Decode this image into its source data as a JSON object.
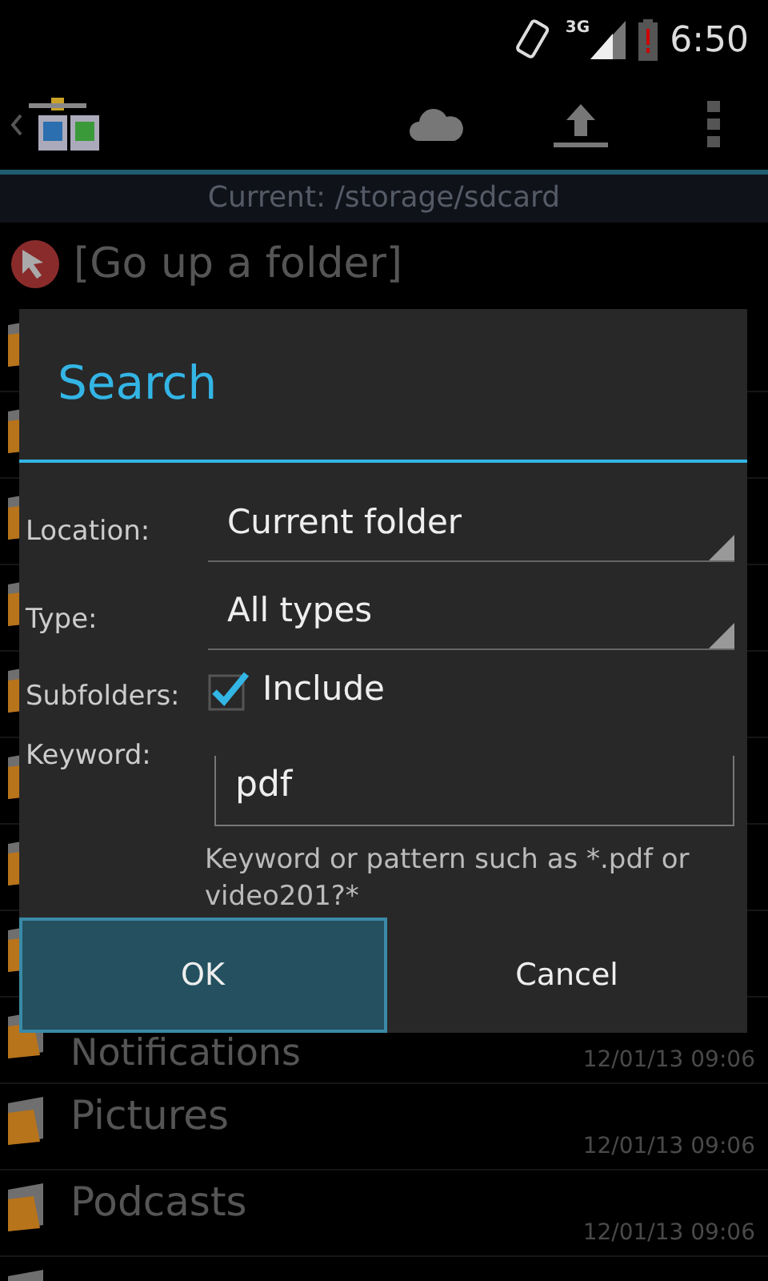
{
  "status_bar": {
    "network": "3G",
    "time": "6:50"
  },
  "action_bar": {
    "path": "Current: /storage/sdcard"
  },
  "go_up": {
    "label": "[Go up a folder]"
  },
  "files": [
    {
      "name": "Notifications",
      "date": "12/01/13 09:06"
    },
    {
      "name": "Pictures",
      "date": "12/01/13 09:06"
    },
    {
      "name": "Podcasts",
      "date": "12/01/13 09:06"
    }
  ],
  "dialog": {
    "title": "Search",
    "fields": [
      {
        "kind": "dropdown",
        "label": "Location:",
        "value": "Current folder"
      },
      {
        "kind": "dropdown",
        "label": "Type:",
        "value": "All types"
      },
      {
        "kind": "checkbox",
        "label": "Subfolders:",
        "value": "Include",
        "checked": true
      },
      {
        "kind": "text",
        "label": "Keyword:",
        "value": "pdf",
        "hint": "Keyword or pattern such as *.pdf or video201?*"
      }
    ],
    "buttons": [
      {
        "label": "OK",
        "selected": true
      },
      {
        "label": "Cancel",
        "selected": false
      }
    ]
  }
}
